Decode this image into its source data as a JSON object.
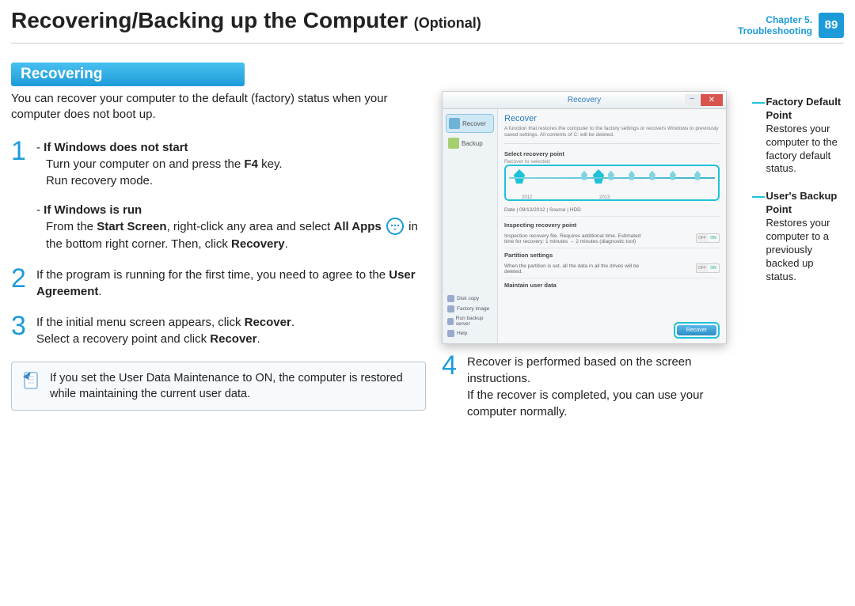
{
  "header": {
    "title_main": "Recovering/Backing up the Computer",
    "title_suffix": "(Optional)",
    "chapter_line1": "Chapter 5.",
    "chapter_line2": "Troubleshooting",
    "page_number": "89"
  },
  "section_heading": "Recovering",
  "intro": "You can recover your computer to the default (factory) status when your computer does not boot up.",
  "step1": {
    "num": "1",
    "sub_a_title": "If Windows does not start",
    "sub_a_line1_before": "Turn your computer on and press the ",
    "sub_a_line1_bold": "F4",
    "sub_a_line1_after": " key.",
    "sub_a_line2": "Run recovery mode.",
    "sub_b_title": "If Windows is run",
    "sub_b_line_1a": "From the ",
    "sub_b_line_1b": "Start Screen",
    "sub_b_line_1c": ", right-click any area and select ",
    "sub_b_line_1d": "All Apps",
    "sub_b_line_2a": " in the bottom right corner. Then, click ",
    "sub_b_line_2b": "Recovery",
    "sub_b_line_2c": "."
  },
  "step2": {
    "num": "2",
    "text_a": "If the program is running for the first time, you need to agree to the ",
    "text_b": "User Agreement",
    "text_c": "."
  },
  "step3": {
    "num": "3",
    "line1_a": "If the initial menu screen appears, click ",
    "line1_b": "Recover",
    "line1_c": ".",
    "line2_a": "Select a recovery point and click ",
    "line2_b": "Recover",
    "line2_c": "."
  },
  "note": "If you set the User Data Maintenance to ON, the computer is restored while maintaining the current user data.",
  "step4": {
    "num": "4",
    "line1": "Recover is performed based on the screen instructions.",
    "line2": "If the recover is completed, you can use your computer normally."
  },
  "screenshot": {
    "window_title": "Recovery",
    "close_label": "✕",
    "min_label": "–",
    "side_recover": "Recover",
    "side_backup": "Backup",
    "main_heading": "Recover",
    "main_desc": "A function that restores the computer to the factory settings or recovers Windows to previously saved settings. All contents of C: will be deleted.",
    "select_point": "Select recovery point",
    "recover_to": "Recover to selected",
    "year_a": "2012",
    "year_b": "2013",
    "date_row": "Date  |  09/13/2012  |  Source  |  HDD",
    "inspect_title": "Inspecting recovery point",
    "inspect_line": "Inspection recovery file. Requires additional time. Estimated time for recovery: 1 minutes → 2 minutes (diagnostic tool)",
    "partition_title": "Partition settings",
    "partition_line": "When the partition is set, all the data in all the drives will be deleted.",
    "maintain_title": "Maintain user data",
    "toggle_off": "OFF",
    "toggle_on": "ON",
    "side_disk": "Disk copy",
    "side_factory": "Factory image",
    "side_run": "Run backup server",
    "side_help": "Help",
    "recover_button": "Recover"
  },
  "callouts": {
    "factory_title": "Factory Default Point",
    "factory_desc": "Restores your computer to the factory default status.",
    "backup_title": "User's Backup Point",
    "backup_desc": "Restores your computer to a previously backed up status."
  }
}
